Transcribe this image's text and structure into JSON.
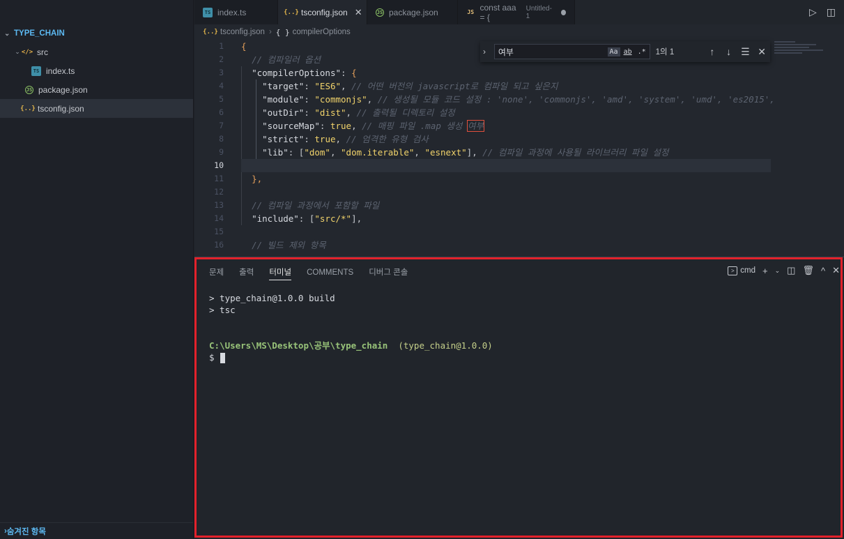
{
  "sidebar": {
    "section_title": "TYPE_CHAIN",
    "items": [
      {
        "label": "src",
        "icon": "folder-icon",
        "depth": 1
      },
      {
        "label": "index.ts",
        "icon": "typescript-file-icon",
        "depth": 2
      },
      {
        "label": "package.json",
        "icon": "nodejs-file-icon",
        "depth": 1
      },
      {
        "label": "tsconfig.json",
        "icon": "json-file-icon",
        "depth": 1
      }
    ],
    "bottom_section": "숨겨진 항목"
  },
  "tabs": [
    {
      "label": "index.ts",
      "icon": "TS"
    },
    {
      "label": "tsconfig.json",
      "icon": "{..}",
      "active": true
    },
    {
      "label": "package.json",
      "icon": "JS"
    },
    {
      "label": "const aaa = {",
      "sub": "Untitled-1",
      "icon": "JS",
      "dirty": true
    }
  ],
  "breadcrumb": {
    "file": "tsconfig.json",
    "symbol": "compilerOptions"
  },
  "find": {
    "value": "여부",
    "match_case": "Aa",
    "whole_word": "ab",
    "regex": ".*",
    "count": "1의 1"
  },
  "editor": {
    "line_numbers": [
      "1",
      "2",
      "3",
      "4",
      "5",
      "6",
      "7",
      "8",
      "9",
      "10",
      "11",
      "12",
      "13",
      "14",
      "15",
      "16"
    ],
    "current_line": "10",
    "lines": {
      "l1": "{",
      "l2_comment": "// 컴파일러 옵션",
      "l3_key": "\"compilerOptions\"",
      "l4_key": "\"target\"",
      "l4_val": "\"ES6\"",
      "l4_comment": "// 어떤 버전의 javascript로 컴파일 되고 싶은지",
      "l5_key": "\"module\"",
      "l5_val": "\"commonjs\"",
      "l5_comment": "// 생성될 모듈 코드 설정 : 'none', 'commonjs', 'amd', 'system', 'umd', 'es2015',",
      "l6_key": "\"outDir\"",
      "l6_val": "\"dist\"",
      "l6_comment": "// 출력될 디렉토리 설정",
      "l7_key": "\"sourceMap\"",
      "l7_val": "true",
      "l7_comment_pre": "// 매핑 파일 .map 생성 ",
      "l7_comment_match": "여부",
      "l8_key": "\"strict\"",
      "l8_val": "true",
      "l8_comment": "// 엄격한 유형 검사",
      "l9_key": "\"lib\"",
      "l9_v1": "\"dom\"",
      "l9_v2": "\"dom.iterable\"",
      "l9_v3": "\"esnext\"",
      "l9_comment": "// 컴파일 과정에 사용될 라이브러리 파일 설정",
      "l11": "},",
      "l13_comment": "// 컴파일 과정에서 포함할 파일",
      "l14_key": "\"include\"",
      "l14_val": "\"src/*\"",
      "l16_comment": "// 빌드 제외 항목"
    }
  },
  "panel": {
    "tabs": [
      "문제",
      "출력",
      "터미널",
      "COMMENTS",
      "디버그 콘솔"
    ],
    "active_tab": "터미널",
    "terminal_name": "cmd",
    "terminal": {
      "line1": "> type_chain@1.0.0 build",
      "line2": "> tsc",
      "path": "C:\\Users\\MS\\Desktop\\공부\\type_chain",
      "pkg": "(type_chain@1.0.0)",
      "prompt": "$"
    }
  },
  "colors": {
    "highlight": "#e3212b",
    "accent": "#5cb8f0"
  }
}
